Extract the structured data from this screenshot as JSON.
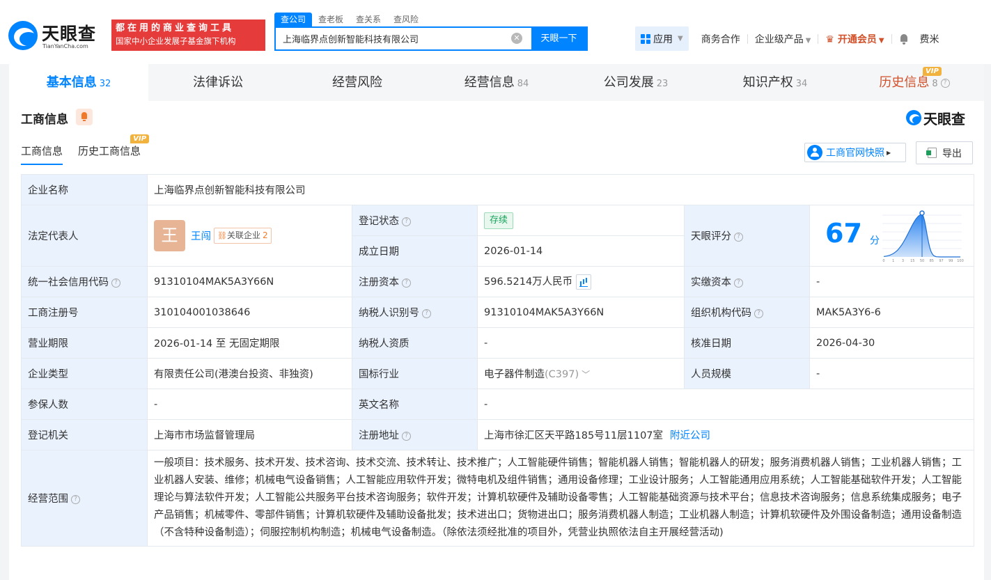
{
  "brand": {
    "name": "天眼查",
    "domain": "TianYanCha.com"
  },
  "slogan": {
    "line1": "都在用的商业查询工具",
    "line2": "国家中小企业发展子基金旗下机构"
  },
  "search": {
    "tabs": [
      "查公司",
      "查老板",
      "查关系",
      "查风险"
    ],
    "value": "上海临界点创新智能科技有限公司",
    "button": "天眼一下"
  },
  "nav": {
    "app": "应用",
    "business": "商务合作",
    "enterprise": "企业级产品",
    "vip": "开通会员",
    "user": "费米"
  },
  "main_tabs": [
    {
      "label": "基本信息",
      "count": "32"
    },
    {
      "label": "法律诉讼",
      "count": ""
    },
    {
      "label": "经营风险",
      "count": ""
    },
    {
      "label": "经营信息",
      "count": "84"
    },
    {
      "label": "公司发展",
      "count": "23"
    },
    {
      "label": "知识产权",
      "count": "34"
    },
    {
      "label": "历史信息",
      "count": "8"
    }
  ],
  "vip_label": "VIP",
  "section": {
    "title": "工商信息",
    "brand": "天眼查",
    "subtabs": [
      "工商信息",
      "历史工商信息"
    ],
    "snapshot_btn": "工商官网快照",
    "export_btn": "导出"
  },
  "info": {
    "company_name_label": "企业名称",
    "company_name": "上海临界点创新智能科技有限公司",
    "legal_rep_label": "法定代表人",
    "legal_rep_avatar": "王",
    "legal_rep_name": "王闯",
    "related_label": "关联企业",
    "related_count": "2",
    "reg_status_label": "登记状态",
    "reg_status": "存续",
    "founded_label": "成立日期",
    "founded": "2026-01-14",
    "score_label": "天眼评分",
    "score": 67,
    "score_unit": "分",
    "credit_code_label": "统一社会信用代码",
    "credit_code": "91310104MAK5A3Y66N",
    "reg_capital_label": "注册资本",
    "reg_capital": "596.5214万人民币",
    "paid_capital_label": "实缴资本",
    "paid_capital": "-",
    "reg_no_label": "工商注册号",
    "reg_no": "310104001038646",
    "taxpayer_id_label": "纳税人识别号",
    "taxpayer_id": "91310104MAK5A3Y66N",
    "org_code_label": "组织机构代码",
    "org_code": "MAK5A3Y6-6",
    "term_label": "营业期限",
    "term": "2026-01-14 至 无固定期限",
    "taxpayer_qual_label": "纳税人资质",
    "taxpayer_qual": "-",
    "approve_date_label": "核准日期",
    "approve_date": "2026-04-30",
    "type_label": "企业类型",
    "type": "有限责任公司(港澳台投资、非独资)",
    "industry_label": "国标行业",
    "industry": "电子器件制造",
    "industry_code": "(C397)",
    "staff_size_label": "人员规模",
    "staff_size": "-",
    "insured_label": "参保人数",
    "insured": "-",
    "english_name_label": "英文名称",
    "english_name": "-",
    "authority_label": "登记机关",
    "authority": "上海市市场监督管理局",
    "address_label": "注册地址",
    "address": "上海市徐汇区天平路185号11层1107室",
    "nearby": "附近公司",
    "scope_label": "经营范围",
    "scope": "一般项目：技术服务、技术开发、技术咨询、技术交流、技术转让、技术推广；人工智能硬件销售；智能机器人销售；智能机器人的研发；服务消费机器人销售；工业机器人销售；工业机器人安装、维修；机械电气设备销售；人工智能应用软件开发；微特电机及组件销售；通用设备修理；工业设计服务；人工智能通用应用系统；人工智能基础软件开发；人工智能理论与算法软件开发；人工智能公共服务平台技术咨询服务；软件开发；计算机软硬件及辅助设备零售；人工智能基础资源与技术平台；信息技术咨询服务；信息系统集成服务；电子产品销售；机械零件、零部件销售；计算机软硬件及辅助设备批发；技术进出口；货物进出口；服务消费机器人制造；工业机器人制造；计算机软硬件及外围设备制造；通用设备制造（不含特种设备制造）；伺服控制机构制造；机械电气设备制造。（除依法须经批准的项目外，凭营业执照依法自主开展经营活动)"
  },
  "score_chart": {
    "ticks": [
      "0",
      "1",
      "3",
      "15",
      "50",
      "85",
      "97",
      "99",
      "100"
    ],
    "marker_tick": "50"
  },
  "colors": {
    "primary": "#0084ff",
    "vip": "#d1502a",
    "label_bg": "#eaf2fe",
    "slogan_bg": "#e63b3b"
  }
}
